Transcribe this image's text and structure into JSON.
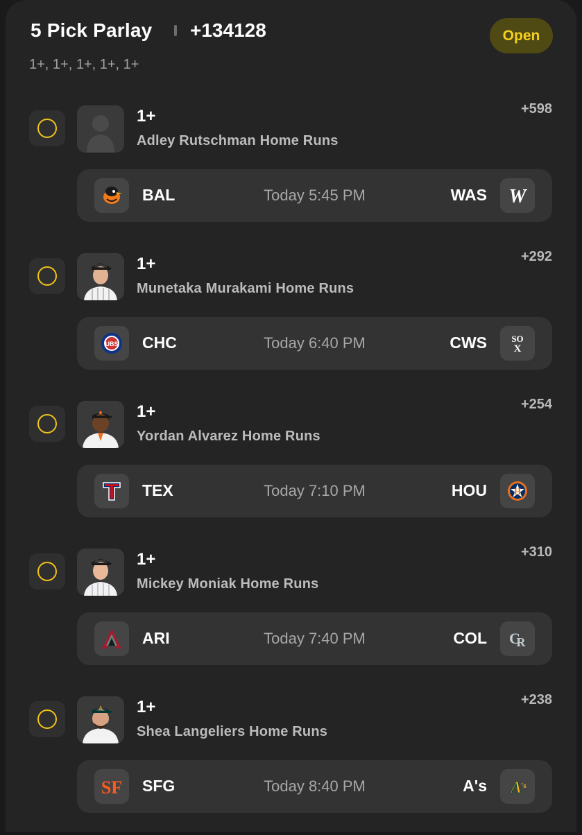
{
  "header": {
    "title": "5 Pick Parlay",
    "odds": "+134128",
    "subtitle": "1+, 1+, 1+, 1+, 1+",
    "status": "Open"
  },
  "colors": {
    "accent_yellow": "#f0c418",
    "badge_bg": "#4f4a14",
    "card_bg": "#242424",
    "game_bg": "#333333"
  },
  "legs": [
    {
      "line": "1+",
      "market": "Adley Rutschman Home Runs",
      "odds": "+598",
      "headshot": "placeholder-silhouette",
      "game": {
        "away": {
          "abbr": "BAL",
          "logo": "orioles-bird-logo"
        },
        "time": "Today 5:45 PM",
        "home": {
          "abbr": "WAS",
          "logo": "nationals-w-logo"
        }
      }
    },
    {
      "line": "1+",
      "market": "Munetaka Murakami Home Runs",
      "odds": "+292",
      "headshot": "player-photo",
      "game": {
        "away": {
          "abbr": "CHC",
          "logo": "cubs-logo"
        },
        "time": "Today 6:40 PM",
        "home": {
          "abbr": "CWS",
          "logo": "white-sox-logo"
        }
      }
    },
    {
      "line": "1+",
      "market": "Yordan Alvarez Home Runs",
      "odds": "+254",
      "headshot": "player-photo",
      "game": {
        "away": {
          "abbr": "TEX",
          "logo": "rangers-t-logo"
        },
        "time": "Today 7:10 PM",
        "home": {
          "abbr": "HOU",
          "logo": "astros-logo"
        }
      }
    },
    {
      "line": "1+",
      "market": "Mickey Moniak Home Runs",
      "odds": "+310",
      "headshot": "player-photo",
      "game": {
        "away": {
          "abbr": "ARI",
          "logo": "diamondbacks-a-logo"
        },
        "time": "Today 7:40 PM",
        "home": {
          "abbr": "COL",
          "logo": "rockies-cr-logo"
        }
      }
    },
    {
      "line": "1+",
      "market": "Shea Langeliers Home Runs",
      "odds": "+238",
      "headshot": "player-photo",
      "game": {
        "away": {
          "abbr": "SFG",
          "logo": "giants-sf-logo"
        },
        "time": "Today 8:40 PM",
        "home": {
          "abbr": "A's",
          "logo": "athletics-logo"
        }
      }
    }
  ]
}
